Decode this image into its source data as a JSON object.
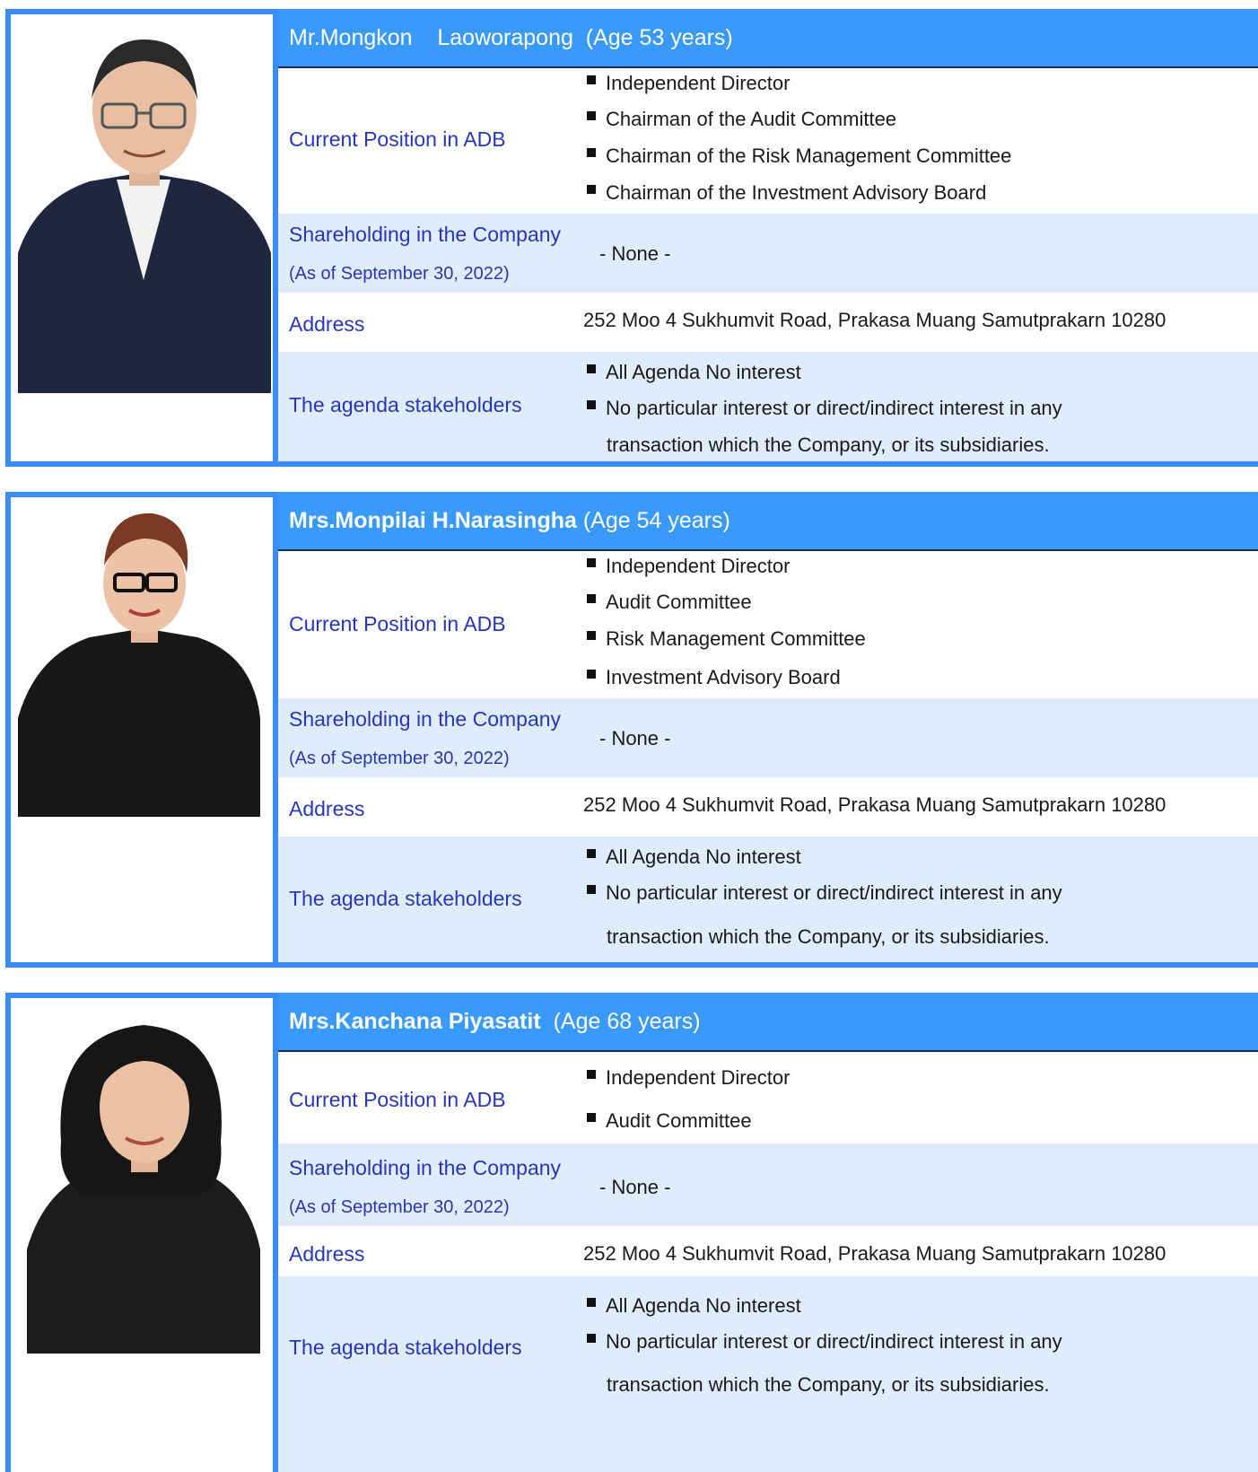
{
  "colors": {
    "accent": "#3a9afc",
    "label": "#2936b8",
    "row_tint": "#deecfb"
  },
  "labels": {
    "position": "Current Position in ADB",
    "shareholding": "Shareholding in the Company",
    "as_of": "(As of September 30, 2022)",
    "address": "Address",
    "agenda": "The agenda stakeholders"
  },
  "directors": [
    {
      "name": "Mr.Mongkon",
      "surname": "Laoworapong",
      "age": "(Age 53 years)",
      "positions": [
        "Independent Director",
        "Chairman of the Audit Committee",
        "Chairman of the Risk Management Committee",
        "Chairman of the Investment Advisory Board"
      ],
      "shareholding": "- None -",
      "address": "252  Moo 4 Sukhumvit Road, Prakasa Muang Samutprakarn 10280",
      "agenda": [
        "All Agenda No interest",
        "No particular interest or direct/indirect interest in any",
        "transaction which the Company, or its subsidiaries."
      ]
    },
    {
      "name": "Mrs.Monpilai H.Narasingha",
      "age": "(Age 54 years)",
      "positions": [
        "Independent Director",
        "Audit Committee",
        "Risk Management Committee",
        "Investment Advisory Board"
      ],
      "shareholding": "- None -",
      "address": "252  Moo 4 Sukhumvit Road, Prakasa Muang Samutprakarn 10280",
      "agenda": [
        "All Agenda No interest",
        "No particular interest or direct/indirect interest in any",
        "transaction which the Company, or its subsidiaries."
      ]
    },
    {
      "name": "Mrs.Kanchana Piyasatit",
      "age": "(Age 68 years)",
      "positions": [
        "Independent Director",
        "Audit Committee"
      ],
      "shareholding": "- None -",
      "address": "252  Moo 4 Sukhumvit Road, Prakasa Muang Samutprakarn 10280",
      "agenda": [
        "All Agenda No interest",
        "No particular interest or direct/indirect interest in any",
        "transaction which the Company, or its subsidiaries."
      ]
    }
  ]
}
